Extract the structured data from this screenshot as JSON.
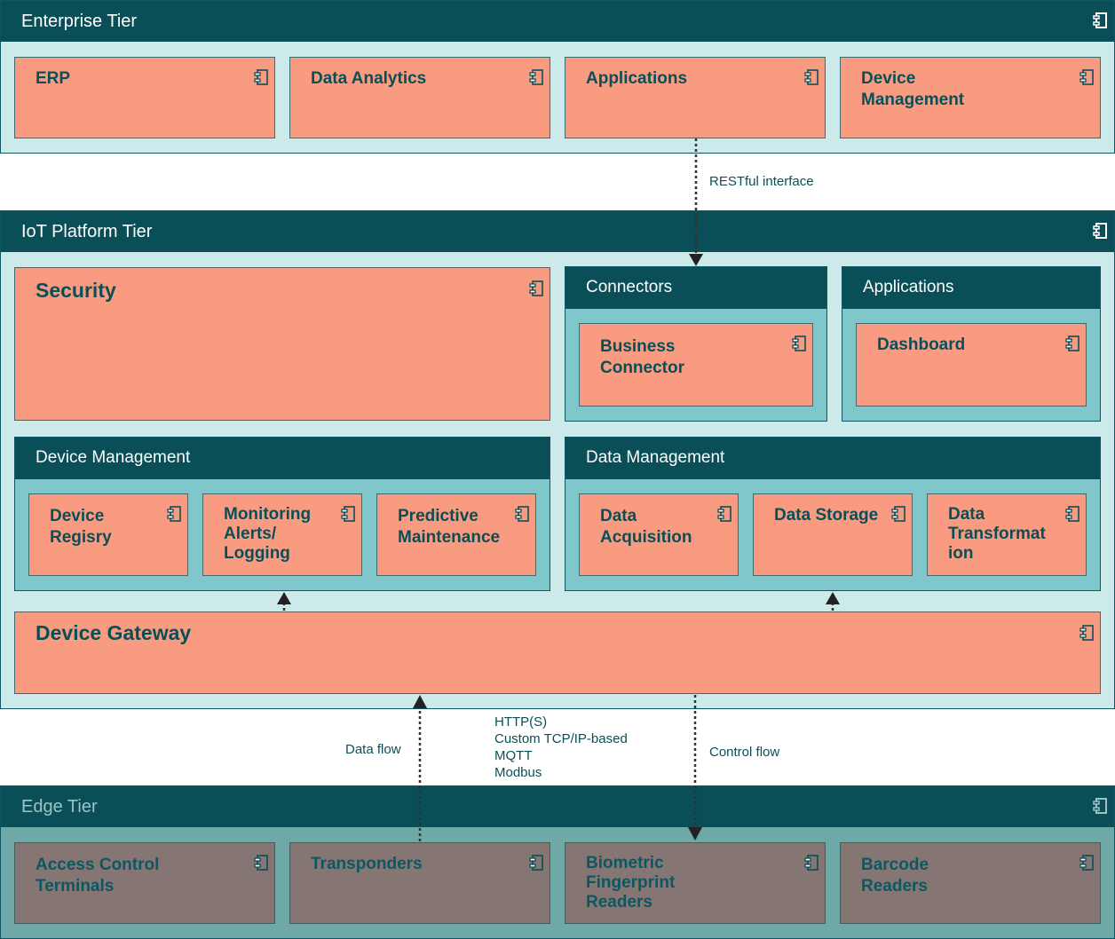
{
  "enterprise": {
    "title": "Enterprise Tier",
    "components": [
      "ERP",
      "Data Analytics",
      "Applications",
      "Device\nManagement"
    ]
  },
  "platform": {
    "title": "IoT Platform Tier",
    "security": "Security",
    "connectors": {
      "title": "Connectors",
      "components": [
        "Business\nConnector"
      ]
    },
    "applications": {
      "title": "Applications",
      "components": [
        "Dashboard"
      ]
    },
    "device_management": {
      "title": "Device Management",
      "components": [
        "Device\nRegisry",
        "Monitoring\nAlerts/\nLogging",
        "Predictive\nMaintenance"
      ]
    },
    "data_management": {
      "title": "Data Management",
      "components": [
        "Data\nAcquisition",
        "Data Storage",
        "Data\nTransformat\nion"
      ]
    },
    "gateway": "Device Gateway"
  },
  "edge": {
    "title": "Edge Tier",
    "components": [
      "Access Control\nTerminals",
      "Transponders",
      "Biometric\nFingerprint\nReaders",
      "Barcode\nReaders"
    ]
  },
  "annotations": {
    "restful": "RESTful interface",
    "data_flow": "Data flow",
    "control_flow": "Control flow",
    "protocols": [
      "HTTP(S)",
      "Custom TCP/IP-based",
      "MQTT",
      "Modbus"
    ]
  },
  "colors": {
    "header": "#0a4f57",
    "tier_bg": "#cdeaea",
    "group_bg": "#7fc7cb",
    "component": "#f99b80",
    "edge_component": "#857673",
    "edge_bg": "#6fa9a7"
  },
  "icons": {
    "component": "component-icon",
    "tier": "tier-component-icon"
  }
}
